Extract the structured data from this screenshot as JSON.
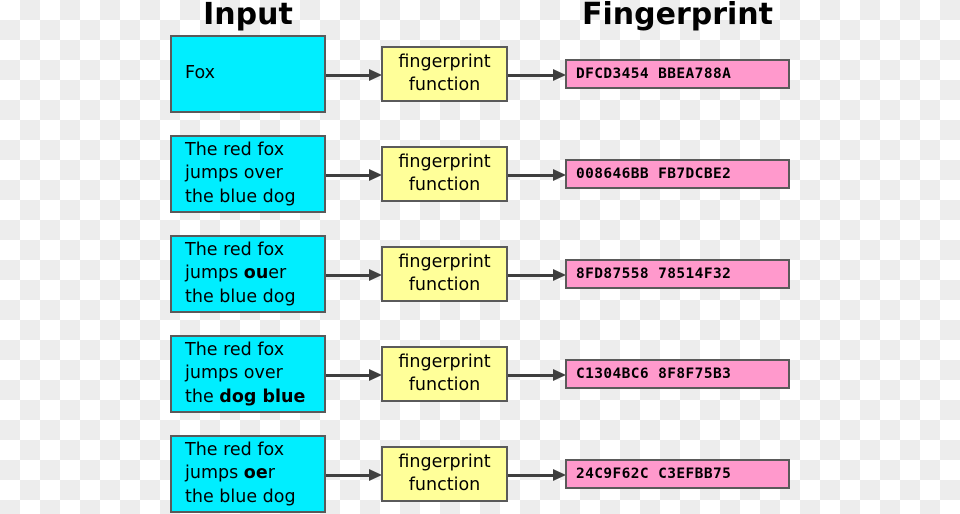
{
  "headers": {
    "input": "Input",
    "fingerprint": "Fingerprint"
  },
  "function_box_label": {
    "line1": "fingerprint",
    "line2": "function"
  },
  "colors": {
    "input_box": "#00eeff",
    "function_box": "#ffff99",
    "fingerprint_box": "#ff99cc",
    "border": "#5a5a5a",
    "arrow": "#3f3f3f",
    "text": "#000000"
  },
  "rows": [
    {
      "input_plain": "Fox",
      "input_segments": [
        {
          "text": "Fox",
          "bold": false
        }
      ],
      "function_line1": "fingerprint",
      "function_line2": "function",
      "fingerprint": "DFCD3454 BBEA788A"
    },
    {
      "input_plain": "The red fox jumps over the blue dog",
      "input_segments": [
        {
          "text": "The red fox",
          "bold": false
        },
        {
          "break": true
        },
        {
          "text": "jumps over",
          "bold": false
        },
        {
          "break": true
        },
        {
          "text": "the blue dog",
          "bold": false
        }
      ],
      "function_line1": "fingerprint",
      "function_line2": "function",
      "fingerprint": "008646BB FB7DCBE2"
    },
    {
      "input_plain": "The red fox jumps ouer the blue dog",
      "input_segments": [
        {
          "text": "The red fox",
          "bold": false
        },
        {
          "break": true
        },
        {
          "text": "jumps ",
          "bold": false
        },
        {
          "text": "ou",
          "bold": true
        },
        {
          "text": "er",
          "bold": false
        },
        {
          "break": true
        },
        {
          "text": "the blue dog",
          "bold": false
        }
      ],
      "function_line1": "fingerprint",
      "function_line2": "function",
      "fingerprint": "8FD87558 78514F32"
    },
    {
      "input_plain": "The red fox jumps over the dog blue",
      "input_segments": [
        {
          "text": "The red fox",
          "bold": false
        },
        {
          "break": true
        },
        {
          "text": "jumps over",
          "bold": false
        },
        {
          "break": true
        },
        {
          "text": "the ",
          "bold": false
        },
        {
          "text": "dog blue",
          "bold": true
        }
      ],
      "function_line1": "fingerprint",
      "function_line2": "function",
      "fingerprint": "C1304BC6 8F8F75B3"
    },
    {
      "input_plain": "The red fox jumps oer the blue dog",
      "input_segments": [
        {
          "text": "The red fox",
          "bold": false
        },
        {
          "break": true
        },
        {
          "text": "jumps ",
          "bold": false
        },
        {
          "text": "oe",
          "bold": true
        },
        {
          "text": "r",
          "bold": false
        },
        {
          "break": true
        },
        {
          "text": "the blue dog",
          "bold": false
        }
      ],
      "function_line1": "fingerprint",
      "function_line2": "function",
      "fingerprint": "24C9F62C C3EFBB75"
    }
  ],
  "layout": {
    "row_tops": [
      35,
      135,
      235,
      335,
      435
    ],
    "input_heights": [
      78,
      78,
      78,
      78,
      78
    ],
    "function_tops": [
      46,
      146,
      246,
      346,
      446
    ],
    "fingerprint_tops": [
      59,
      159,
      259,
      359,
      459
    ],
    "arrow_tops": [
      69,
      169,
      269,
      369,
      469
    ]
  }
}
